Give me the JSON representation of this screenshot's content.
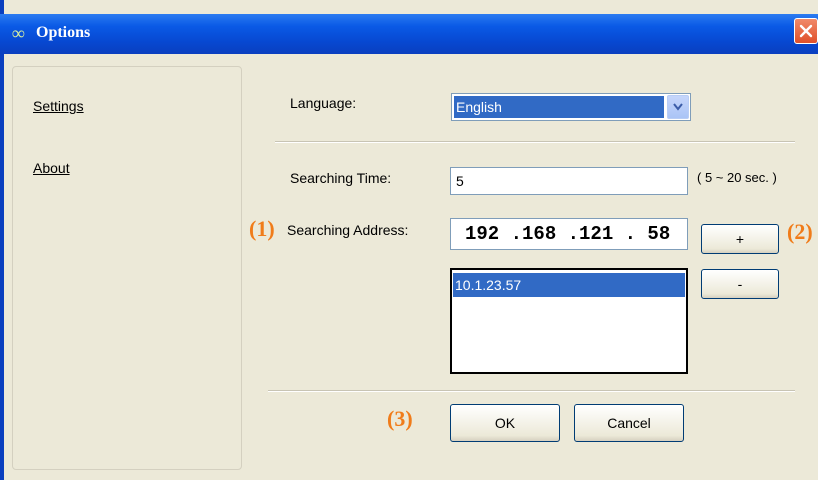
{
  "window": {
    "title": "Options",
    "icon": "link-icon"
  },
  "sidebar": {
    "items": [
      {
        "label": "Settings"
      },
      {
        "label": "About"
      }
    ]
  },
  "settings": {
    "language_label": "Language:",
    "language_value": "English",
    "searching_time_label": "Searching Time:",
    "searching_time_value": "5",
    "searching_time_hint": "( 5 ~ 20 sec. )",
    "searching_address_label": "Searching Address:",
    "searching_address_value": "192 .168 .121 . 58",
    "address_list": [
      "10.1.23.57"
    ],
    "add_label": "+",
    "remove_label": "-"
  },
  "footer": {
    "ok_label": "OK",
    "cancel_label": "Cancel"
  },
  "annotations": {
    "marker1": "(1)",
    "marker2": "(2)",
    "marker3": "(3)"
  },
  "colors": {
    "titlebar": "#0a5ae6",
    "selection": "#316ac5",
    "marker": "#f07c1a",
    "close": "#e0502a"
  }
}
